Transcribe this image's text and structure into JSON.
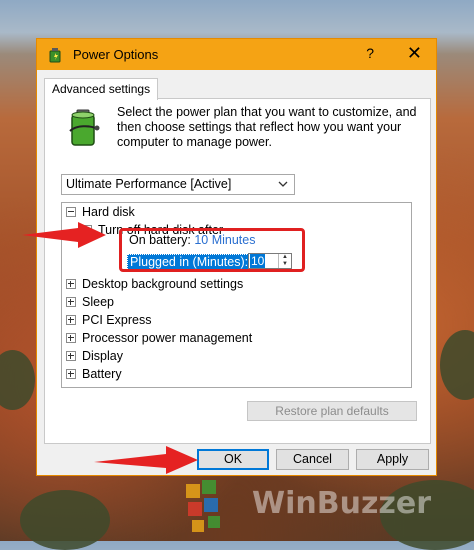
{
  "window": {
    "title": "Power Options",
    "help": "?",
    "close": "✕"
  },
  "tab": {
    "label": "Advanced settings"
  },
  "description": "Select the power plan that you want to customize, and then choose settings that reflect how you want your computer to manage power.",
  "plan": {
    "selected": "Ultimate Performance [Active]"
  },
  "tree": {
    "hard_disk": "Hard disk",
    "turn_off": "Turn off hard disk after",
    "on_battery_label": "On battery:",
    "on_battery_value": "10 Minutes",
    "plugged_label": "Plugged in (Minutes):",
    "plugged_value": "10",
    "items": [
      "Desktop background settings",
      "Sleep",
      "PCI Express",
      "Processor power management",
      "Display",
      "Battery"
    ]
  },
  "buttons": {
    "restore": "Restore plan defaults",
    "ok": "OK",
    "cancel": "Cancel",
    "apply": "Apply"
  },
  "watermark": "WinBuzzer",
  "colors": {
    "title_bar": "#f5a314",
    "selection": "#0078d7",
    "highlight": "#e02020",
    "link_value": "#2a6fd0"
  }
}
